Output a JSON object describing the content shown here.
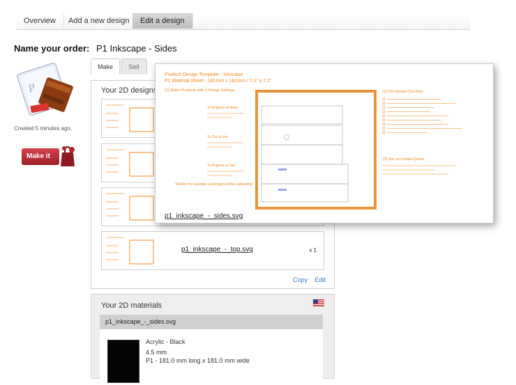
{
  "top_tabs": [
    {
      "label": "Overview"
    },
    {
      "label": "Add a new design"
    },
    {
      "label": "Edit a design"
    }
  ],
  "order": {
    "label": "Name your order:",
    "name": "P1 Inkscape - Sides"
  },
  "created": "Created 5 minutes ago.",
  "make_button": "Make it",
  "mode_tabs": [
    {
      "label": "Make"
    },
    {
      "label": "Sell"
    }
  ],
  "designs": {
    "title": "Your 2D designs",
    "rows": [
      {
        "name": "",
        "qty": ""
      },
      {
        "name": "",
        "qty": ""
      },
      {
        "name": "",
        "qty": ""
      },
      {
        "name": "p1_inkscape_-_top.svg",
        "qty": "x 1"
      }
    ],
    "copy_label": "Copy",
    "edit_label": "Edit"
  },
  "materials": {
    "title": "Your 2D materials",
    "file": "p1_inkscape_-_sides.svg",
    "material": "Acrylic - Black",
    "thickness": "4.5 mm",
    "size": "P1 - 181.0 mm long x 181.0 mm wide",
    "swatch_color": "#050505"
  },
  "preview": {
    "title": "Product Design Template - Inkscape",
    "subtitle": "P1 Material Sheet - 181mm x 181mm / 7.1\" x 7.1\"",
    "step1": "(1) Make Products with 3 Design Settings",
    "step2": "(2) Pre-Quote Checklist",
    "step3": "(3) Get an Instant Quote",
    "note": "*Delete the example cut designs before uploading!",
    "setting1": "To Engrave an Area",
    "setting2": "To Cut a Line",
    "setting3": "To Engrave a Line",
    "filename": "p1_inkscape_-_sides.svg",
    "accent_color": "#f08a1c"
  }
}
